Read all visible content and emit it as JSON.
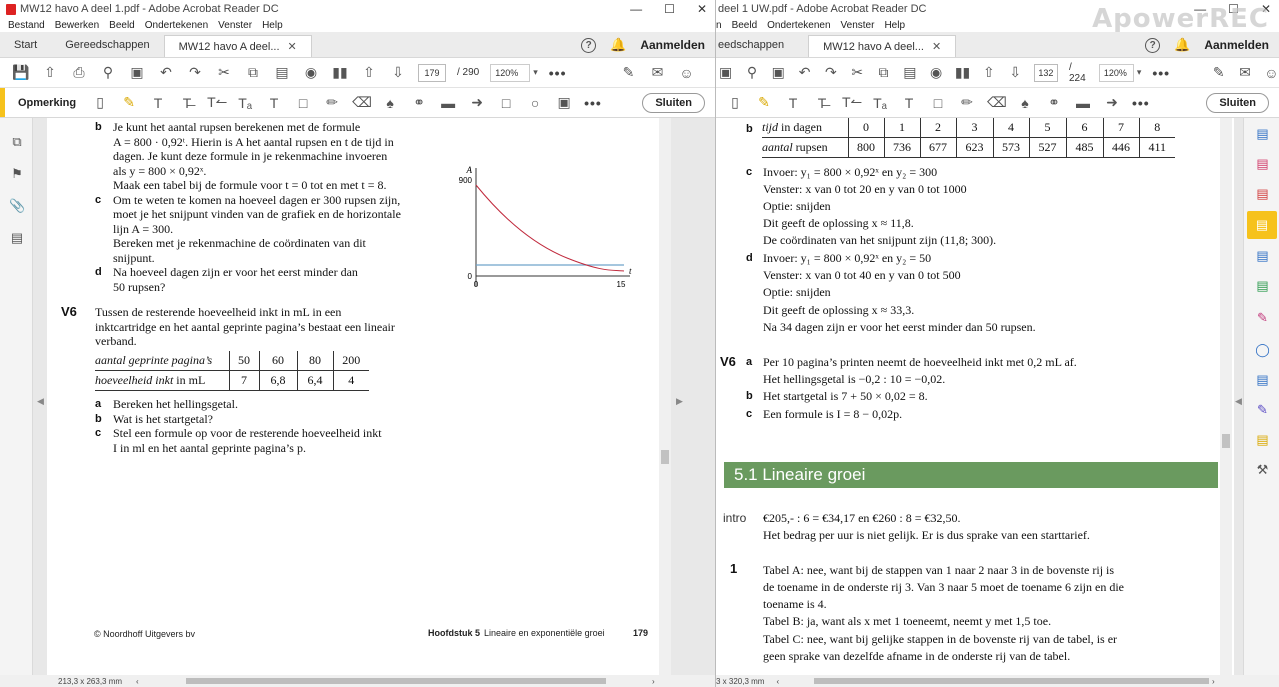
{
  "left": {
    "title": "MW12 havo A deel 1.pdf - Adobe Acrobat Reader DC",
    "menus": [
      "Bestand",
      "Bewerken",
      "Beeld",
      "Ondertekenen",
      "Venster",
      "Help"
    ],
    "tabs": [
      "Start",
      "Gereedschappen"
    ],
    "doc_tab": "MW12 havo A deel...",
    "help": "?",
    "login": "Aanmelden",
    "page_current": "179",
    "page_total": "/ 290",
    "zoom": "120%",
    "comment_label": "Opmerking",
    "close_label": "Sluiten",
    "status_size": "213,3 x 263,3 mm",
    "content": {
      "b_label": "b",
      "b_lines": [
        "Je kunt het aantal rupsen berekenen met de formule",
        "A = 800 · 0,92ᵗ. Hierin is A het aantal rupsen en t de tijd in",
        "dagen. Je kunt deze formule in je rekenmachine invoeren",
        "als y = 800 × 0,92ˣ.",
        "Maak een tabel bij de formule voor t = 0 tot en met t = 8."
      ],
      "c_label": "c",
      "c_lines": [
        "Om te weten te komen na hoeveel dagen er 300 rupsen zijn,",
        "moet je het snijpunt vinden van de grafiek en de horizontale",
        "lijn A = 300.",
        "Bereken met je rekenmachine de coördinaten van dit",
        "snijpunt."
      ],
      "d_label": "d",
      "d_lines": [
        "Na hoeveel dagen zijn er voor het eerst minder dan",
        "50 rupsen?"
      ],
      "graph": {
        "y_axis": "A",
        "x_axis": "t",
        "y_max": "900",
        "y_zero": "0",
        "x_zero": "0",
        "x_max": "15"
      },
      "v6_num": "V6",
      "v6_lines": [
        "Tussen de resterende hoeveelheid inkt in mL in een",
        "inktcartridge en het aantal geprinte pagina’s bestaat een lineair",
        "verband."
      ],
      "table_row1_head": "aantal geprinte pagina’s",
      "table_row1": [
        "50",
        "60",
        "80",
        "200"
      ],
      "table_row2_head": "hoeveelheid inkt in mL",
      "table_row2": [
        "7",
        "6,8",
        "6,4",
        "4"
      ],
      "a_label": "a",
      "a_text": "Bereken het hellingsgetal.",
      "b2_label": "b",
      "b2_text": "Wat is het startgetal?",
      "c2_label": "c",
      "c2_lines": [
        "Stel een formule op voor de resterende hoeveelheid inkt",
        "I in ml en het aantal geprinte pagina’s p."
      ],
      "footer_left": "© Noordhoff Uitgevers bv",
      "footer_chapter": "Hoofdstuk 5",
      "footer_title": "Lineaire en exponentiële groei",
      "footer_page": "179"
    }
  },
  "right": {
    "title": "deel 1 UW.pdf - Adobe Acrobat Reader DC",
    "menus": [
      "n",
      "Beeld",
      "Ondertekenen",
      "Venster",
      "Help"
    ],
    "tab_partial": "eedschappen",
    "doc_tab": "MW12 havo A deel...",
    "help": "?",
    "login": "Aanmelden",
    "page_current": "132",
    "page_total": "/ 224",
    "zoom": "120%",
    "close_label": "Sluiten",
    "status_size": "3 x 320,3 mm",
    "watermark": "ApowerREC",
    "content": {
      "b_label": "b",
      "tijd_head": "tijd in dagen",
      "tijd": [
        "0",
        "1",
        "2",
        "3",
        "4",
        "5",
        "6",
        "7",
        "8"
      ],
      "aantal_head": "aantal rupsen",
      "aantal": [
        "800",
        "736",
        "677",
        "623",
        "573",
        "527",
        "485",
        "446",
        "411"
      ],
      "c_label": "c",
      "c_lines": [
        "Invoer: y₁ = 800 × 0,92ˣ en y₂ = 300",
        "Venster: x van 0 tot 20 en y van 0 tot 1000",
        "Optie: snijden",
        "Dit geeft de oplossing x ≈ 11,8.",
        "De coördinaten van het snijpunt zijn (11,8; 300)."
      ],
      "d_label": "d",
      "d_lines": [
        "Invoer: y₁ = 800 × 0,92ˣ en y₂ = 50",
        "Venster: x van 0 tot 40 en y van 0 tot 500",
        "Optie: snijden",
        "Dit geeft de oplossing x ≈ 33,3.",
        "Na 34 dagen zijn er voor het eerst minder dan 50 rupsen."
      ],
      "v6_num": "V6",
      "v6_a_label": "a",
      "v6_a_lines": [
        "Per 10 pagina’s printen neemt de hoeveelheid inkt met 0,2 mL af.",
        "Het hellingsgetal is −0,2 : 10 = −0,02."
      ],
      "v6_b_label": "b",
      "v6_b_text": "Het startgetal is 7 + 50 × 0,02 = 8.",
      "v6_c_label": "c",
      "v6_c_text": "Een formule is I = 8 − 0,02p.",
      "section": "5.1  Lineaire groei",
      "intro_label": "intro",
      "intro_lines": [
        "€205,- : 6 = €34,17 en €260 : 8 = €32,50.",
        "Het bedrag per uur is niet gelijk. Er is dus sprake van een starttarief."
      ],
      "q1_num": "1",
      "q1_lines": [
        "Tabel A: nee, want bij de stappen van 1 naar 2 naar 3 in de bovenste rij is",
        "de toename in de onderste rij 3. Van 3 naar 5 moet de toename 6 zijn en die",
        "toename is 4.",
        "Tabel B: ja, want als x met 1 toeneemt, neemt y met 1,5 toe.",
        "Tabel C: nee, want bij gelijke stappen in de bovenste rij van de tabel, is er",
        "geen sprake van dezelfde afname in de onderste rij van de tabel."
      ]
    }
  },
  "colors": {
    "accent_yellow": "#f6c21c",
    "section_green": "#6a9a5f",
    "graph_curve": "#c0293c",
    "graph_line": "#6fa3c9",
    "tool_blue": "#2f6fc4"
  }
}
